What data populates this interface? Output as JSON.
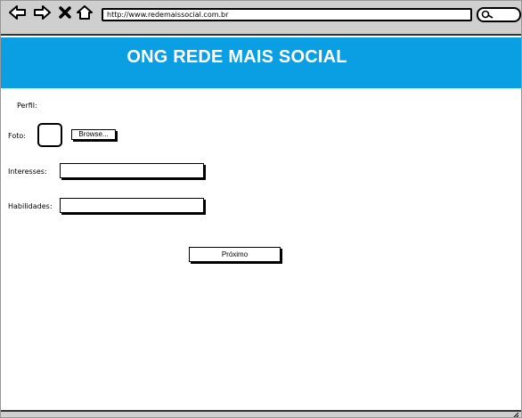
{
  "browser": {
    "url": "http://www.redemaissocial.com.br",
    "icons": [
      "back-arrow-icon",
      "forward-arrow-icon",
      "close-x-icon",
      "home-icon",
      "search-icon"
    ]
  },
  "header": {
    "title": "ONG REDE MAIS SOCIAL",
    "background": "#0a9ee3"
  },
  "form": {
    "section_label": "Perfil:",
    "photo_label": "Foto:",
    "browse_label": "Browse...",
    "interests_label": "Interesses:",
    "interests_value": "",
    "skills_label": "Habilidades:",
    "skills_value": "",
    "next_label": "Próximo"
  }
}
